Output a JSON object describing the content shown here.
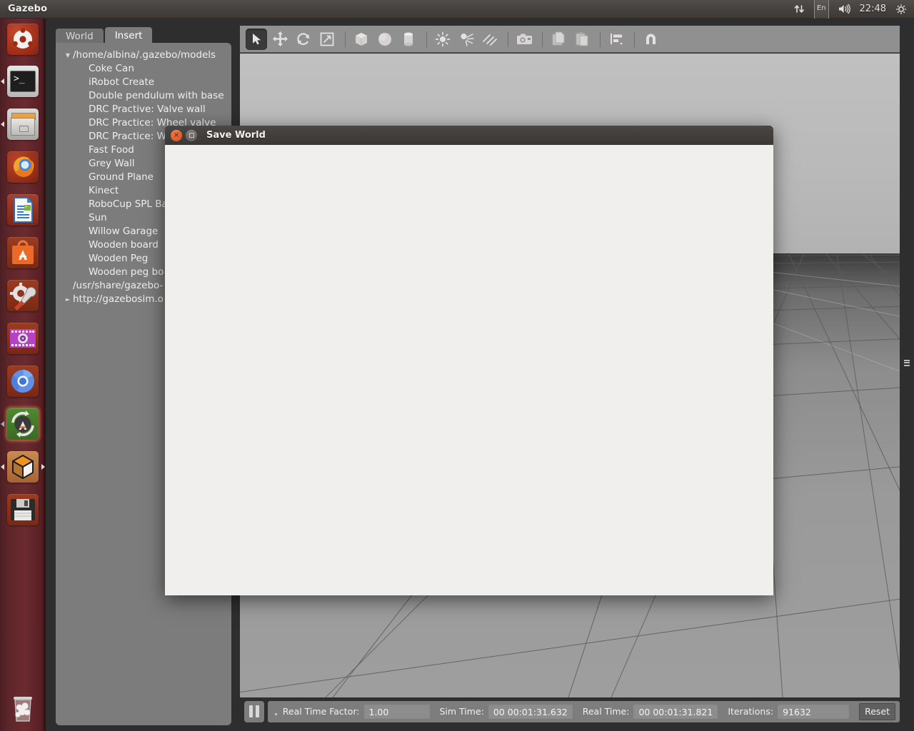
{
  "top_panel": {
    "app_title": "Gazebo",
    "tray": {
      "network_icon": "network-updown-icon",
      "keyboard_layout": "En",
      "volume_icon": "volume-icon",
      "clock": "22:48",
      "session_icon": "session-gear-icon"
    }
  },
  "launcher": {
    "items": [
      {
        "name": "ubuntu-dash",
        "label": "Ubuntu Dash",
        "icon": "ubuntu-logo-icon",
        "running": false,
        "focused": false
      },
      {
        "name": "terminal",
        "label": "Terminal",
        "icon": "terminal-icon",
        "running": true,
        "focused": false
      },
      {
        "name": "files",
        "label": "Files",
        "icon": "file-cabinet-icon",
        "running": true,
        "focused": false
      },
      {
        "name": "firefox",
        "label": "Firefox",
        "icon": "firefox-icon",
        "running": false,
        "focused": false
      },
      {
        "name": "libreoffice-writer",
        "label": "LibreOffice Writer",
        "icon": "document-icon",
        "running": false,
        "focused": false
      },
      {
        "name": "ubuntu-software",
        "label": "Ubuntu Software Center",
        "icon": "software-bag-icon",
        "running": false,
        "focused": false
      },
      {
        "name": "system-settings",
        "label": "System Settings",
        "icon": "gear-wrench-icon",
        "running": false,
        "focused": false
      },
      {
        "name": "media-player",
        "label": "Media Player",
        "icon": "film-strip-icon",
        "running": false,
        "focused": false
      },
      {
        "name": "chromium",
        "label": "Chromium",
        "icon": "chromium-icon",
        "running": false,
        "focused": false
      },
      {
        "name": "software-updater",
        "label": "Software Updater",
        "icon": "update-refresh-icon",
        "running": true,
        "focused": false
      },
      {
        "name": "gazebo",
        "label": "Gazebo",
        "icon": "gazebo-cube-icon",
        "running": true,
        "focused": true
      },
      {
        "name": "save-disk",
        "label": "Floppy Disk",
        "icon": "floppy-disk-icon",
        "running": false,
        "focused": false
      },
      {
        "name": "trash",
        "label": "Trash",
        "icon": "trash-bin-icon",
        "running": false,
        "focused": false
      }
    ]
  },
  "panel": {
    "tabs": [
      {
        "name": "world",
        "label": "World",
        "active": false
      },
      {
        "name": "insert",
        "label": "Insert",
        "active": true
      }
    ],
    "tree": [
      {
        "label": "/home/albina/.gazebo/models",
        "level": "root",
        "arrow": "expanded"
      },
      {
        "label": "Coke Can",
        "level": "child",
        "arrow": "none"
      },
      {
        "label": "iRobot Create",
        "level": "child",
        "arrow": "none"
      },
      {
        "label": "Double pendulum with base",
        "level": "child",
        "arrow": "none"
      },
      {
        "label": "DRC Practive: Valve wall",
        "level": "child",
        "arrow": "none"
      },
      {
        "label": "DRC Practice: Wheel valve",
        "level": "child",
        "arrow": "none"
      },
      {
        "label": "DRC Practice: W",
        "level": "child",
        "arrow": "none"
      },
      {
        "label": "Fast Food",
        "level": "child",
        "arrow": "none"
      },
      {
        "label": "Grey Wall",
        "level": "child",
        "arrow": "none"
      },
      {
        "label": "Ground Plane",
        "level": "child",
        "arrow": "none"
      },
      {
        "label": "Kinect",
        "level": "child",
        "arrow": "none"
      },
      {
        "label": "RoboCup SPL Ba",
        "level": "child",
        "arrow": "none"
      },
      {
        "label": "Sun",
        "level": "child",
        "arrow": "none"
      },
      {
        "label": "Willow Garage",
        "level": "child",
        "arrow": "none"
      },
      {
        "label": "Wooden board",
        "level": "child",
        "arrow": "none"
      },
      {
        "label": "Wooden Peg",
        "level": "child",
        "arrow": "none"
      },
      {
        "label": "Wooden peg bo",
        "level": "child",
        "arrow": "none"
      },
      {
        "label": "/usr/share/gazebo-",
        "level": "group",
        "arrow": "none"
      },
      {
        "label": "http://gazebosim.o",
        "level": "group-exp",
        "arrow": "collapsed"
      }
    ]
  },
  "toolbar": {
    "buttons": [
      {
        "name": "select-tool",
        "icon": "arrow-cursor-icon",
        "active": true
      },
      {
        "name": "translate-tool",
        "icon": "move-arrows-icon",
        "active": false
      },
      {
        "name": "rotate-tool",
        "icon": "rotate-arrows-icon",
        "active": false
      },
      {
        "name": "scale-tool",
        "icon": "scale-diagonal-icon",
        "active": false
      },
      {
        "name": "insert-box",
        "icon": "box-icon",
        "active": false
      },
      {
        "name": "insert-sphere",
        "icon": "sphere-icon",
        "active": false
      },
      {
        "name": "insert-cylinder",
        "icon": "cylinder-icon",
        "active": false
      },
      {
        "name": "insert-point-light",
        "icon": "point-light-icon",
        "active": false
      },
      {
        "name": "insert-spot-light",
        "icon": "spot-light-icon",
        "active": false
      },
      {
        "name": "insert-directional-light",
        "icon": "directional-light-icon",
        "active": false
      },
      {
        "name": "screenshot",
        "icon": "camera-icon",
        "active": false
      },
      {
        "name": "copy",
        "icon": "copy-icon",
        "active": false
      },
      {
        "name": "paste",
        "icon": "paste-icon",
        "active": false
      },
      {
        "name": "align",
        "icon": "align-icon",
        "active": false
      },
      {
        "name": "snap",
        "icon": "magnet-icon",
        "active": false
      }
    ]
  },
  "status_bar": {
    "play_pause_icon": "pause-icon",
    "real_time_factor_label": "Real Time Factor:",
    "real_time_factor_value": "1.00",
    "sim_time_label": "Sim Time:",
    "sim_time_value": "00 00:01:31.632",
    "real_time_label": "Real Time:",
    "real_time_value": "00 00:01:31.821",
    "iterations_label": "Iterations:",
    "iterations_value": "91632",
    "reset_label": "Reset"
  },
  "dialog": {
    "title": "Save World",
    "close_glyph": "×",
    "close_icon": "close-icon",
    "maximize_icon": "maximize-icon"
  },
  "colors": {
    "launcher_bg": "#5d262a",
    "panel_bg": "#7c7c7c",
    "toolbar_bg": "#909090",
    "dialog_bg": "#f0efed",
    "accent_orange": "#dd4814",
    "window_chrome": "#413e3b"
  }
}
